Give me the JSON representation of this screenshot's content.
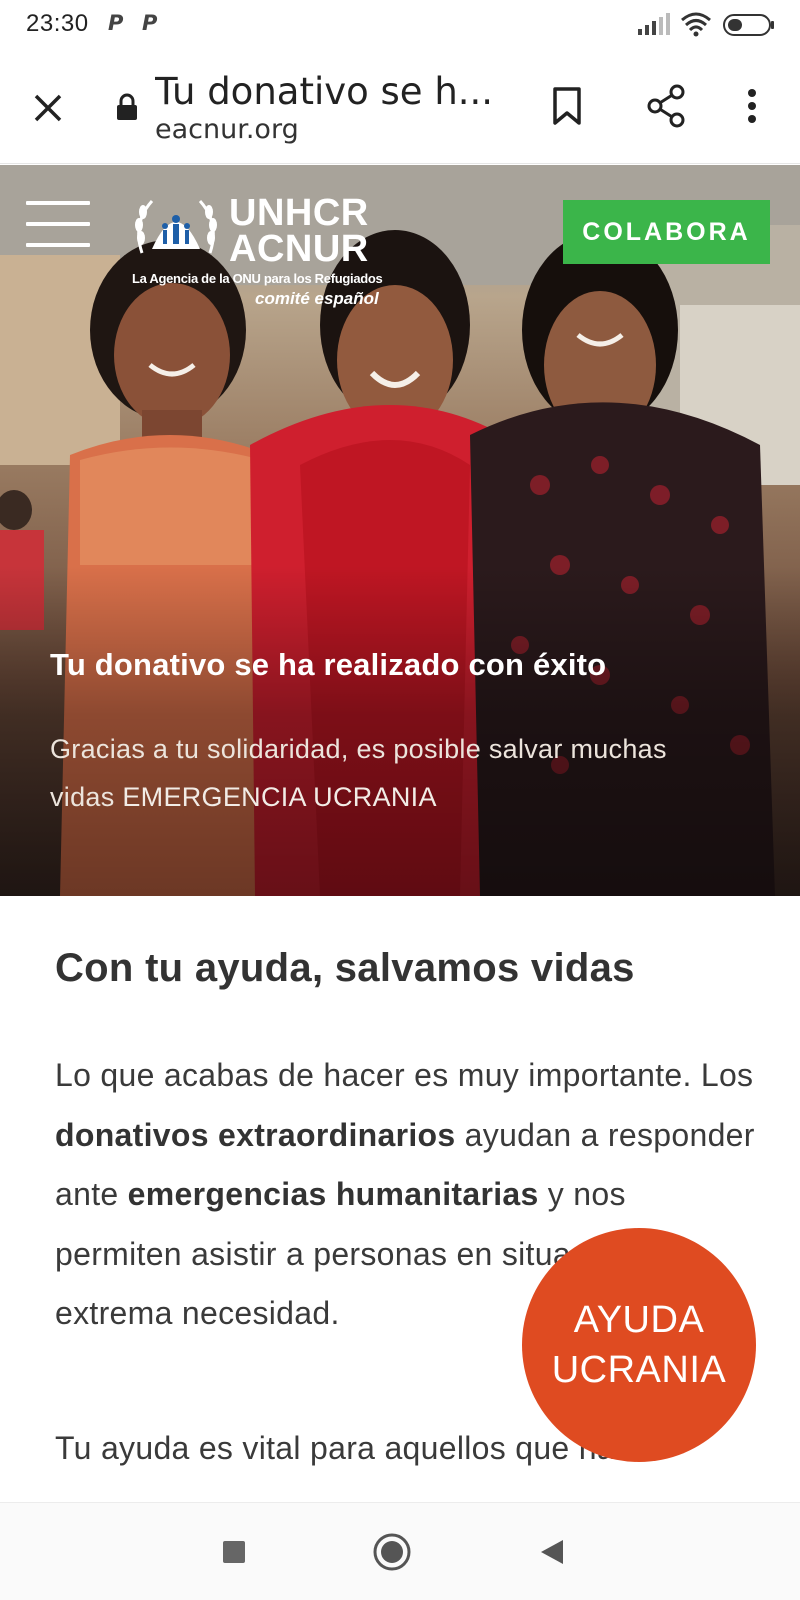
{
  "status_bar": {
    "time": "23:30",
    "notification_icons": [
      "P",
      "P"
    ],
    "signal_icon": "signal-icon",
    "wifi_icon": "wifi-icon",
    "battery_icon": "battery-icon"
  },
  "toolbar": {
    "title": "Tu donativo se h...",
    "url": "eacnur.org",
    "close_icon": "close-icon",
    "lock_icon": "lock-icon",
    "bookmark_icon": "bookmark-icon",
    "share_icon": "share-icon",
    "more_icon": "more-vert-icon"
  },
  "hero": {
    "logo": {
      "line1": "UNHCR",
      "line2": "ACNUR",
      "tagline": "La Agencia de la ONU para los Refugiados",
      "committee": "comité español"
    },
    "cta_label": "COLABORA",
    "cta_color": "#3bb54a",
    "title": "Tu donativo se ha realizado con éxito",
    "subtitle_part1": "Gracias a tu solidaridad, es posible salvar muchas vidas",
    "subtitle_part2": "EMERGENCIA UCRANIA"
  },
  "content": {
    "heading": "Con tu ayuda, salvamos vidas",
    "paragraph": {
      "t1": "Lo que acabas de hacer es muy importante. Los ",
      "b1": "donativos extraordinarios",
      "t2": " ayudan a responder ante ",
      "b2": "emergencias humanitarias",
      "t3": " y nos permiten asistir a personas en situación de extrema necesidad."
    },
    "paragraph2": "Tu ayuda es vital para aquellos que han"
  },
  "badge": {
    "line1": "AYUDA",
    "line2": "UCRANIA",
    "color": "#df4b21"
  },
  "navbar": {
    "recents_icon": "recents-square-icon",
    "home_icon": "home-circle-icon",
    "back_icon": "back-triangle-icon"
  }
}
